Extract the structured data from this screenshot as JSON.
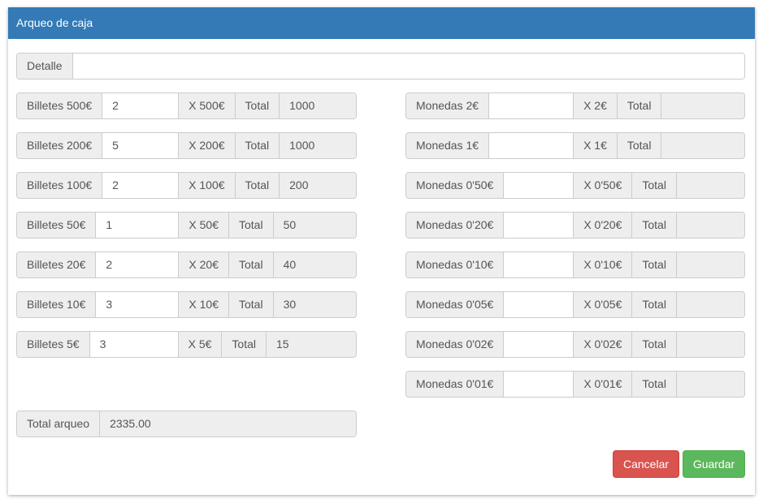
{
  "panel": {
    "title": "Arqueo de caja"
  },
  "detalle": {
    "label": "Detalle",
    "value": ""
  },
  "billetes": [
    {
      "label": "Billetes 500€",
      "qty": "2",
      "mult": "X 500€",
      "total_label": "Total",
      "total": "1000"
    },
    {
      "label": "Billetes 200€",
      "qty": "5",
      "mult": "X 200€",
      "total_label": "Total",
      "total": "1000"
    },
    {
      "label": "Billetes 100€",
      "qty": "2",
      "mult": "X 100€",
      "total_label": "Total",
      "total": "200"
    },
    {
      "label": "Billetes 50€",
      "qty": "1",
      "mult": "X 50€",
      "total_label": "Total",
      "total": "50"
    },
    {
      "label": "Billetes 20€",
      "qty": "2",
      "mult": "X 20€",
      "total_label": "Total",
      "total": "40"
    },
    {
      "label": "Billetes 10€",
      "qty": "3",
      "mult": "X 10€",
      "total_label": "Total",
      "total": "30"
    },
    {
      "label": "Billetes 5€",
      "qty": "3",
      "mult": "X 5€",
      "total_label": "Total",
      "total": "15"
    }
  ],
  "monedas": [
    {
      "label": "Monedas 2€",
      "qty": "",
      "mult": "X 2€",
      "total_label": "Total",
      "total": ""
    },
    {
      "label": "Monedas 1€",
      "qty": "",
      "mult": "X 1€",
      "total_label": "Total",
      "total": ""
    },
    {
      "label": "Monedas 0'50€",
      "qty": "",
      "mult": "X 0'50€",
      "total_label": "Total",
      "total": ""
    },
    {
      "label": "Monedas 0'20€",
      "qty": "",
      "mult": "X 0'20€",
      "total_label": "Total",
      "total": ""
    },
    {
      "label": "Monedas 0'10€",
      "qty": "",
      "mult": "X 0'10€",
      "total_label": "Total",
      "total": ""
    },
    {
      "label": "Monedas 0'05€",
      "qty": "",
      "mult": "X 0'05€",
      "total_label": "Total",
      "total": ""
    },
    {
      "label": "Monedas 0'02€",
      "qty": "",
      "mult": "X 0'02€",
      "total_label": "Total",
      "total": ""
    },
    {
      "label": "Monedas 0'01€",
      "qty": "",
      "mult": "X 0'01€",
      "total_label": "Total",
      "total": ""
    }
  ],
  "total_arqueo": {
    "label": "Total arqueo",
    "value": "2335.00"
  },
  "buttons": {
    "cancel": "Cancelar",
    "save": "Guardar"
  },
  "colors": {
    "header": "#337ab7",
    "cancel": "#d9534f",
    "save": "#5cb85c",
    "addon": "#eeeeee"
  }
}
